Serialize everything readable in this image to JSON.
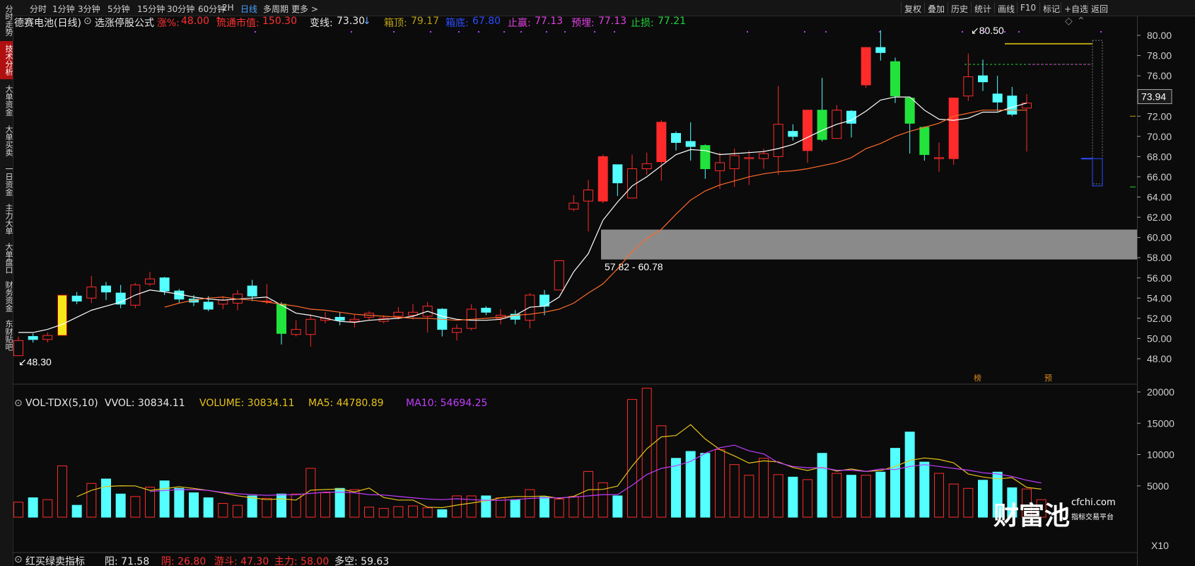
{
  "left_tabs": [
    {
      "label": "分时走势",
      "active": false
    },
    {
      "label": "技术分析",
      "active": true
    },
    {
      "label": "大单资金",
      "active": false
    },
    {
      "label": "大单买卖",
      "active": false
    },
    {
      "label": "一日资金",
      "active": false
    },
    {
      "label": "主力大单",
      "active": false
    },
    {
      "label": "大单盘口",
      "active": false
    },
    {
      "label": "财务资金",
      "active": false
    },
    {
      "label": "东财贴吧",
      "active": false
    }
  ],
  "periods": [
    "分时",
    "1分钟",
    "3分钟",
    "5分钟",
    "15分钟",
    "30分钟",
    "60分钟",
    "2H",
    "日线",
    "多周期",
    "更多 >"
  ],
  "active_period": "日线",
  "right_toolbar": [
    "复权",
    "叠加",
    "历史",
    "统计",
    "画线",
    "F10",
    "标记",
    "+自选",
    "返回"
  ],
  "info": {
    "stock": "德赛电池(日线)",
    "formula": "选涨停股公式",
    "change_label": "涨%:",
    "change_value": "48.00",
    "mcap_label": "流通市值:",
    "mcap_value": "150.30",
    "line_label": "变线:",
    "line_value": "73.30",
    "top_label": "箱顶:",
    "top_value": "79.17",
    "bottom_label": "箱底:",
    "bottom_value": "67.80",
    "profit_label": "止赢:",
    "profit_value": "77.13",
    "warn_label": "预埋:",
    "warn_value": "77.13",
    "stop_label": "止损:",
    "stop_value": "77.21"
  },
  "price_axis": [
    "80.00",
    "78.00",
    "76.00",
    "74.00",
    "72.00",
    "70.00",
    "68.00",
    "66.00",
    "64.00",
    "62.00",
    "60.00",
    "58.00",
    "56.00",
    "54.00",
    "52.00",
    "50.00",
    "48.00"
  ],
  "current_price": "73.94",
  "high_label": "80.50",
  "low_label": "48.30",
  "gap_label": "57.82 - 60.78",
  "marks": [
    "榜",
    "预"
  ],
  "volume": {
    "title": "VOL-TDX(5,10)",
    "vvol": "VVOL: 30834.11",
    "volume": "VOLUME: 30834.11",
    "ma5": "MA5: 44780.89",
    "ma10": "MA10: 54694.25"
  },
  "volume_axis": [
    "20000",
    "15000",
    "10000",
    "5000"
  ],
  "volume_unit": "X10",
  "bottom": {
    "title": "红买绿卖指标",
    "v1": "阳: 71.58",
    "v2": "阴: 26.80",
    "v3": "游斗: 47.30",
    "v4": "主力: 58.00",
    "v5": "多空: 59.63"
  },
  "watermark": {
    "brand": "财富池",
    "site": "cfchi.com",
    "sub": "指标交易平台"
  },
  "colors": {
    "up": "#ff2b2b",
    "down": "#54ffff",
    "ma5": "#ffffff",
    "ma10": "#ff6a2a",
    "vol_ma5": "#e6c21a",
    "vol_ma10": "#c13cff",
    "gap": "#8a8a8a",
    "limit_up": "#f5e61a",
    "limit_down": "#22e33c"
  },
  "chart_data": [
    {
      "type": "candlestick",
      "title": "德赛电池(日线)",
      "candles": [
        {
          "o": 48.3,
          "c": 49.8,
          "h": 50.2,
          "l": 48.3
        },
        {
          "o": 50.2,
          "c": 49.9,
          "h": 50.5,
          "l": 49.6
        },
        {
          "o": 49.9,
          "c": 50.3,
          "h": 50.6,
          "l": 49.6
        },
        {
          "o": 50.3,
          "c": 54.3,
          "h": 54.3,
          "l": 50.3,
          "lu": 1
        },
        {
          "o": 54.2,
          "c": 53.7,
          "h": 54.6,
          "l": 53.4
        },
        {
          "o": 54.0,
          "c": 55.1,
          "h": 56.2,
          "l": 53.5
        },
        {
          "o": 55.2,
          "c": 54.6,
          "h": 55.6,
          "l": 53.8
        },
        {
          "o": 54.5,
          "c": 53.4,
          "h": 55.3,
          "l": 53.0
        },
        {
          "o": 53.3,
          "c": 55.3,
          "h": 55.5,
          "l": 53.0
        },
        {
          "o": 55.4,
          "c": 55.9,
          "h": 56.6,
          "l": 55.2
        },
        {
          "o": 56.0,
          "c": 54.7,
          "h": 56.1,
          "l": 54.3
        },
        {
          "o": 54.7,
          "c": 53.9,
          "h": 54.9,
          "l": 53.5
        },
        {
          "o": 53.9,
          "c": 53.6,
          "h": 54.3,
          "l": 53.2
        },
        {
          "o": 53.6,
          "c": 52.9,
          "h": 54.2,
          "l": 52.7
        },
        {
          "o": 53.4,
          "c": 53.8,
          "h": 54.2,
          "l": 52.9
        },
        {
          "o": 53.5,
          "c": 54.4,
          "h": 54.8,
          "l": 52.8
        },
        {
          "o": 55.2,
          "c": 54.2,
          "h": 55.8,
          "l": 53.7
        },
        {
          "o": 53.7,
          "c": 53.7,
          "h": 55.4,
          "l": 53.4
        },
        {
          "o": 53.4,
          "c": 50.5,
          "h": 53.6,
          "l": 49.4
        },
        {
          "o": 50.4,
          "c": 50.9,
          "h": 51.8,
          "l": 50.2
        },
        {
          "o": 50.4,
          "c": 51.9,
          "h": 52.4,
          "l": 49.2
        },
        {
          "o": 51.8,
          "c": 52.0,
          "h": 52.6,
          "l": 51.5
        },
        {
          "o": 52.1,
          "c": 51.8,
          "h": 52.6,
          "l": 51.3
        },
        {
          "o": 51.7,
          "c": 51.9,
          "h": 52.4,
          "l": 51.1
        },
        {
          "o": 52.1,
          "c": 52.5,
          "h": 52.7,
          "l": 51.8
        },
        {
          "o": 51.7,
          "c": 52.0,
          "h": 52.3,
          "l": 51.5
        },
        {
          "o": 52.2,
          "c": 52.6,
          "h": 53.1,
          "l": 51.9
        },
        {
          "o": 52.3,
          "c": 52.6,
          "h": 53.4,
          "l": 51.9
        },
        {
          "o": 52.2,
          "c": 53.2,
          "h": 53.6,
          "l": 50.6
        },
        {
          "o": 52.9,
          "c": 50.9,
          "h": 53.0,
          "l": 50.2
        },
        {
          "o": 50.6,
          "c": 51.0,
          "h": 51.4,
          "l": 49.8
        },
        {
          "o": 51.0,
          "c": 52.9,
          "h": 53.4,
          "l": 50.8
        },
        {
          "o": 53.0,
          "c": 52.6,
          "h": 53.2,
          "l": 52.3
        },
        {
          "o": 52.0,
          "c": 52.3,
          "h": 52.9,
          "l": 51.4
        },
        {
          "o": 52.4,
          "c": 51.9,
          "h": 52.8,
          "l": 51.4
        },
        {
          "o": 51.8,
          "c": 54.3,
          "h": 54.5,
          "l": 51.0
        },
        {
          "o": 54.3,
          "c": 53.2,
          "h": 54.8,
          "l": 52.3
        },
        {
          "o": 54.8,
          "c": 57.7,
          "h": 57.7,
          "l": 54.8
        },
        {
          "o": 62.8,
          "c": 63.4,
          "h": 64.2,
          "l": 62.6
        },
        {
          "o": 63.6,
          "c": 64.7,
          "h": 65.7,
          "l": 60.6
        },
        {
          "o": 63.6,
          "c": 68.0,
          "h": 68.2,
          "l": 63.4
        },
        {
          "o": 67.2,
          "c": 65.4,
          "h": 67.2,
          "l": 64.1
        },
        {
          "o": 63.9,
          "c": 66.8,
          "h": 68.2,
          "l": 63.9
        },
        {
          "o": 66.8,
          "c": 67.3,
          "h": 68.4,
          "l": 66.2
        },
        {
          "o": 67.5,
          "c": 71.4,
          "h": 71.6,
          "l": 65.6
        },
        {
          "o": 70.3,
          "c": 69.4,
          "h": 70.5,
          "l": 68.6
        },
        {
          "o": 69.5,
          "c": 69.0,
          "h": 71.4,
          "l": 67.6
        },
        {
          "o": 69.1,
          "c": 66.8,
          "h": 69.2,
          "l": 65.8
        },
        {
          "o": 66.6,
          "c": 67.4,
          "h": 68.4,
          "l": 64.8
        },
        {
          "o": 66.8,
          "c": 68.1,
          "h": 68.8,
          "l": 65.0
        },
        {
          "o": 67.8,
          "c": 67.9,
          "h": 68.6,
          "l": 65.2
        },
        {
          "o": 67.8,
          "c": 68.3,
          "h": 68.8,
          "l": 66.8
        },
        {
          "o": 68.0,
          "c": 71.2,
          "h": 75.0,
          "l": 66.2
        },
        {
          "o": 70.5,
          "c": 70.0,
          "h": 71.2,
          "l": 69.6
        },
        {
          "o": 68.6,
          "c": 72.6,
          "h": 72.6,
          "l": 67.4
        },
        {
          "o": 72.6,
          "c": 69.7,
          "h": 75.8,
          "l": 69.5
        },
        {
          "o": 69.8,
          "c": 72.6,
          "h": 73.1,
          "l": 69.8
        },
        {
          "o": 72.5,
          "c": 71.3,
          "h": 72.6,
          "l": 69.9
        },
        {
          "o": 75.1,
          "c": 78.8,
          "h": 78.8,
          "l": 74.8
        },
        {
          "o": 78.8,
          "c": 78.3,
          "h": 80.5,
          "l": 77.5
        },
        {
          "o": 77.4,
          "c": 74.0,
          "h": 77.8,
          "l": 73.3
        },
        {
          "o": 73.8,
          "c": 71.3,
          "h": 73.8,
          "l": 68.3
        },
        {
          "o": 70.9,
          "c": 68.2,
          "h": 71.0,
          "l": 67.6
        },
        {
          "o": 67.8,
          "c": 67.9,
          "h": 69.4,
          "l": 66.5
        },
        {
          "o": 67.8,
          "c": 73.8,
          "h": 73.8,
          "l": 67.2
        },
        {
          "o": 74.0,
          "c": 75.9,
          "h": 78.2,
          "l": 73.5
        },
        {
          "o": 76.0,
          "c": 75.4,
          "h": 77.6,
          "l": 74.5
        },
        {
          "o": 74.2,
          "c": 73.4,
          "h": 76.0,
          "l": 72.5
        },
        {
          "o": 74.0,
          "c": 72.2,
          "h": 74.9,
          "l": 72.0
        },
        {
          "o": 72.8,
          "c": 73.3,
          "h": 74.2,
          "l": 68.5
        }
      ],
      "ma5": [
        50.6,
        50.6,
        50.9,
        51.4,
        52.1,
        52.8,
        53.2,
        53.6,
        54.3,
        54.8,
        54.6,
        54.4,
        54.1,
        53.9,
        53.8,
        53.9,
        54.0,
        54.1,
        53.3,
        52.5,
        52.3,
        52.0,
        51.7,
        51.6,
        51.8,
        51.9,
        52.0,
        52.2,
        52.7,
        52.2,
        51.9,
        51.8,
        51.8,
        51.9,
        52.3,
        53.1,
        53.2,
        54.1,
        56.6,
        58.4,
        61.7,
        63.5,
        65.1,
        66.0,
        67.1,
        68.2,
        68.7,
        68.6,
        68.2,
        68.3,
        68.4,
        68.5,
        68.8,
        69.2,
        69.9,
        70.6,
        71.2,
        71.6,
        72.5,
        73.6,
        73.9,
        73.9,
        72.6,
        71.7,
        71.6,
        71.8,
        72.4,
        72.4,
        72.9,
        73.3
      ],
      "ma10": [
        null,
        null,
        null,
        null,
        null,
        null,
        null,
        null,
        null,
        null,
        53.1,
        53.5,
        53.8,
        54.0,
        54.1,
        53.9,
        53.8,
        53.6,
        53.4,
        53.2,
        52.9,
        52.8,
        52.6,
        52.4,
        52.3,
        52.2,
        52.1,
        52.0,
        52.0,
        51.9,
        51.8,
        51.9,
        52.0,
        52.1,
        52.3,
        52.4,
        52.6,
        52.9,
        53.5,
        54.5,
        55.4,
        56.9,
        58.6,
        59.9,
        60.8,
        62.3,
        63.7,
        64.6,
        65.2,
        65.6,
        66.0,
        66.3,
        66.5,
        66.6,
        66.8,
        67.1,
        67.4,
        67.9,
        68.8,
        69.3,
        70.0,
        70.5,
        70.9,
        71.3,
        72.0,
        72.3,
        72.6,
        72.6,
        72.6,
        72.6
      ],
      "gap_range": [
        57.82,
        60.78
      ],
      "box": {
        "top": 79.17,
        "bottom": 67.8
      },
      "ylim": [
        47.5,
        81.0
      ]
    },
    {
      "type": "bar",
      "title": "VOL-TDX(5,10)",
      "volume": [
        2400,
        3100,
        2800,
        8200,
        1900,
        5400,
        6100,
        3700,
        3300,
        4800,
        5800,
        4600,
        3900,
        3100,
        2200,
        1900,
        3400,
        3000,
        3700,
        3700,
        7800,
        3900,
        4600,
        4400,
        1600,
        1400,
        1700,
        1800,
        1500,
        1200,
        3400,
        3400,
        3400,
        3100,
        2800,
        4400,
        3200,
        2900,
        3300,
        7300,
        5500,
        3400,
        18800,
        20600,
        14600,
        9400,
        10500,
        10200,
        10800,
        8400,
        6700,
        9400,
        6800,
        6400,
        6000,
        10200,
        7000,
        6700,
        6700,
        7200,
        11000,
        13600,
        8800,
        7000,
        5300,
        4600,
        5900,
        7200,
        4700,
        4500,
        2800
      ],
      "ma5": [
        null,
        null,
        null,
        null,
        3280,
        4280,
        4900,
        5020,
        5000,
        4280,
        4560,
        4860,
        4600,
        4270,
        3880,
        3410,
        3100,
        2800,
        2940,
        2740,
        4320,
        4420,
        4500,
        4040,
        4640,
        3140,
        2740,
        2740,
        1600,
        1520,
        1920,
        2260,
        2600,
        3100,
        3300,
        3300,
        3380,
        3000,
        3320,
        4380,
        4440,
        4960,
        8160,
        10920,
        12820,
        13040,
        14780,
        12500,
        10800,
        9780,
        8640,
        9000,
        8820,
        7940,
        7460,
        8000,
        7360,
        7700,
        7300,
        7460,
        8100,
        9060,
        9460,
        9220,
        8680,
        6900,
        6420,
        6120,
        6320,
        4760,
        4478
      ],
      "ma10": [
        null,
        null,
        null,
        null,
        null,
        null,
        null,
        null,
        null,
        4100,
        4260,
        4400,
        4420,
        4270,
        3960,
        3740,
        3600,
        3490,
        3570,
        3600,
        3800,
        4000,
        4000,
        3900,
        3600,
        3540,
        3320,
        3100,
        2900,
        2800,
        2940,
        2800,
        2700,
        2700,
        2800,
        3000,
        3100,
        3100,
        3200,
        3400,
        3600,
        3600,
        5100,
        6800,
        7800,
        8200,
        8900,
        10200,
        11100,
        11500,
        10600,
        10100,
        8700,
        8100,
        7900,
        7900,
        7500,
        7500,
        7300,
        7700,
        7600,
        8100,
        8400,
        8100,
        7800,
        7500,
        7100,
        6900,
        6500,
        5900,
        5469
      ],
      "ylim": [
        0,
        22000
      ]
    }
  ]
}
